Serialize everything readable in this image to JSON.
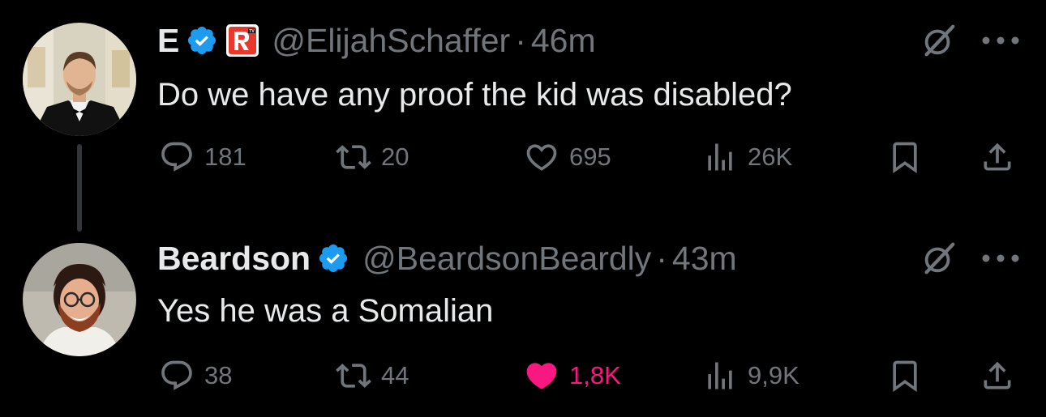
{
  "tweets": [
    {
      "display_name": "E",
      "handle": "@ElijahSchaffer",
      "separator": "·",
      "time": "46m",
      "text": "Do we have any proof the kid was disabled?",
      "replies": "181",
      "retweets": "20",
      "likes": "695",
      "views": "26K",
      "liked": false,
      "affiliate_badge": "RTV"
    },
    {
      "display_name": "Beardson",
      "handle": "@BeardsonBeardly",
      "separator": "·",
      "time": "43m",
      "text": "Yes he was a Somalian",
      "replies": "38",
      "retweets": "44",
      "likes": "1,8K",
      "views": "9,9K",
      "liked": true
    }
  ],
  "colors": {
    "background": "#000000",
    "text": "#e7e9ea",
    "secondary": "#71767b",
    "verified": "#1d9bf0",
    "like_active": "#f91880",
    "affiliate_red": "#e8382c"
  },
  "icons": [
    "reply-icon",
    "retweet-icon",
    "heart-icon",
    "views-icon",
    "bookmark-icon",
    "share-icon",
    "verified-icon",
    "grok-icon",
    "more-icon"
  ]
}
